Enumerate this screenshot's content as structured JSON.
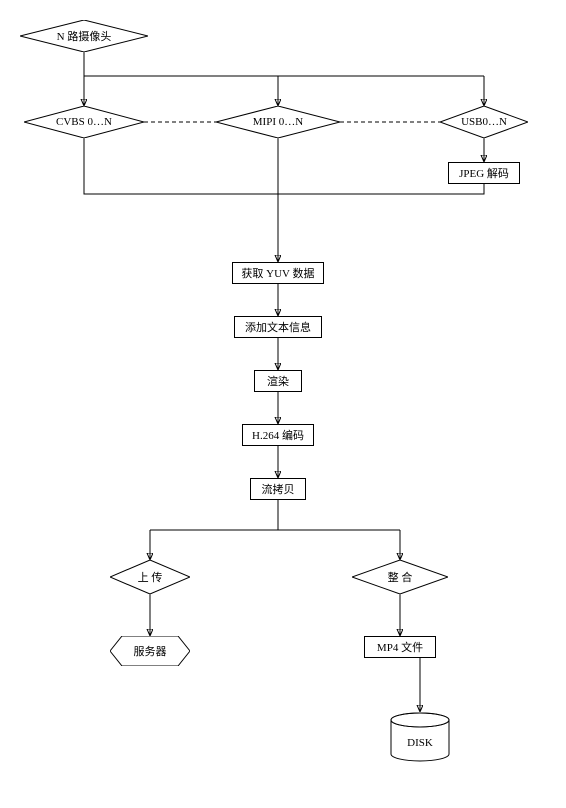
{
  "title": {
    "label": "N 路摄像头"
  },
  "interfaces": {
    "cvbs": {
      "label": "CVBS 0…N"
    },
    "mipi": {
      "label": "MIPI 0…N"
    },
    "usb": {
      "label": "USB0…N"
    }
  },
  "jpeg": {
    "label": "JPEG 解码"
  },
  "yuv": {
    "label": "获取 YUV 数据"
  },
  "text": {
    "label": "添加文本信息"
  },
  "render": {
    "label": "渲染"
  },
  "h264": {
    "label": "H.264 编码"
  },
  "copy": {
    "label": "流拷贝"
  },
  "upload": {
    "label": "上 传"
  },
  "server": {
    "label": "服务器"
  },
  "merge": {
    "label": "整  合"
  },
  "mp4": {
    "label": "MP4 文件"
  },
  "disk": {
    "label": "DISK"
  }
}
